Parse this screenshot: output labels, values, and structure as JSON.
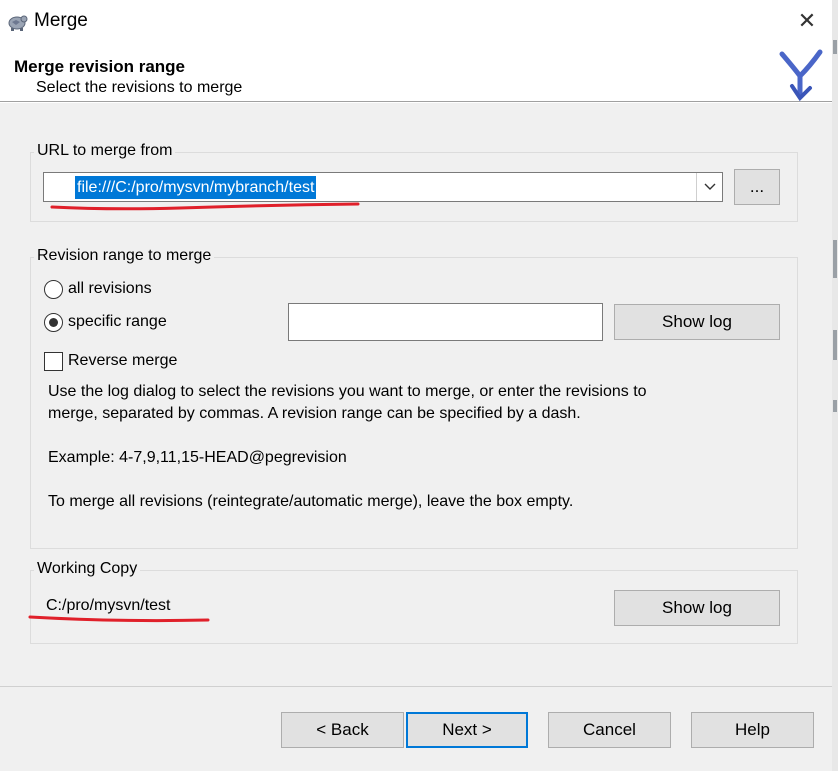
{
  "window": {
    "title": "Merge",
    "close_glyph": "✕"
  },
  "header": {
    "title": "Merge revision range",
    "subtitle": "Select the revisions to merge",
    "logo_icon": "tortoisesvn-merge-logo-icon"
  },
  "url_group": {
    "label": "URL to merge from",
    "url_value": "file:///C:/pro/mysvn/mybranch/test",
    "browse_label": "..."
  },
  "revision_group": {
    "label": "Revision range to merge",
    "option_all": "all revisions",
    "option_specific": "specific range",
    "selected_option": "specific range",
    "range_value": "",
    "show_log_label": "Show log",
    "reverse_label": "Reverse merge",
    "reverse_checked": false,
    "help_line1": "Use the log dialog to select the revisions you want to merge, or enter the revisions to",
    "help_line2": "merge, separated by commas. A revision range can be specified by a dash.",
    "example": "Example: 4-7,9,11,15-HEAD@pegrevision",
    "note": "To merge all revisions (reintegrate/automatic merge), leave the box empty."
  },
  "working_copy_group": {
    "label": "Working Copy",
    "path": "C:/pro/mysvn/test",
    "show_log_label": "Show log"
  },
  "footer": {
    "back_label": "< Back",
    "next_label": "Next >",
    "cancel_label": "Cancel",
    "help_label": "Help"
  },
  "colors": {
    "accent": "#0078d7",
    "annotation_red": "#e0202a",
    "dialog_bg": "#f0f0f0"
  }
}
